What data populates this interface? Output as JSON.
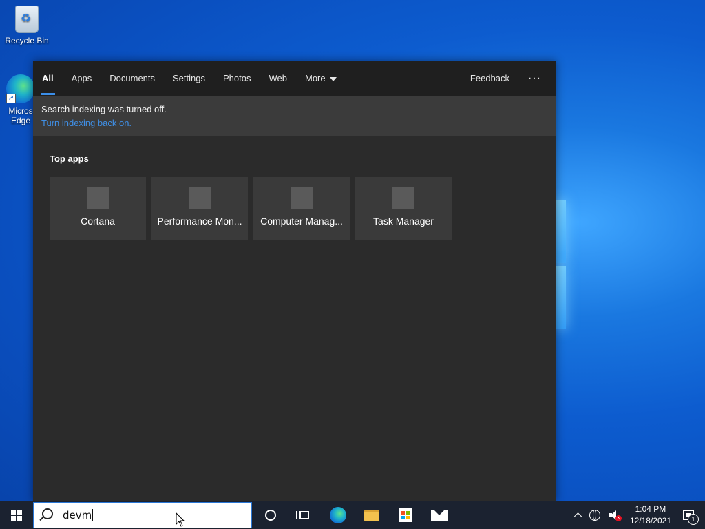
{
  "desktop": {
    "icons": [
      {
        "label": "Recycle Bin",
        "icon": "recycle-bin-icon"
      },
      {
        "label": "Micros\nEdge",
        "icon": "edge-icon"
      }
    ]
  },
  "search_flyout": {
    "tabs": [
      {
        "label": "All",
        "active": true
      },
      {
        "label": "Apps"
      },
      {
        "label": "Documents"
      },
      {
        "label": "Settings"
      },
      {
        "label": "Photos"
      },
      {
        "label": "Web"
      },
      {
        "label": "More"
      }
    ],
    "feedback_label": "Feedback",
    "options_label": "···",
    "notice": {
      "message": "Search indexing was turned off.",
      "link": "Turn indexing back on."
    },
    "section_title": "Top apps",
    "top_apps": [
      {
        "label": "Cortana"
      },
      {
        "label": "Performance Mon..."
      },
      {
        "label": "Computer Manag..."
      },
      {
        "label": "Task Manager"
      }
    ]
  },
  "taskbar": {
    "search_value": "devm",
    "pinned": [
      "cortana-icon",
      "task-view-icon",
      "edge-icon",
      "file-explorer-icon",
      "store-icon",
      "mail-icon"
    ],
    "clock": {
      "time": "1:04 PM",
      "date": "12/18/2021"
    },
    "notification_count": "1"
  },
  "colors": {
    "accent": "#3b8ee8",
    "link": "#3f8fe6",
    "flyout_bg": "#2b2b2b",
    "tile_bg": "#3a3a3a",
    "taskbar_bg": "#1b2230"
  }
}
